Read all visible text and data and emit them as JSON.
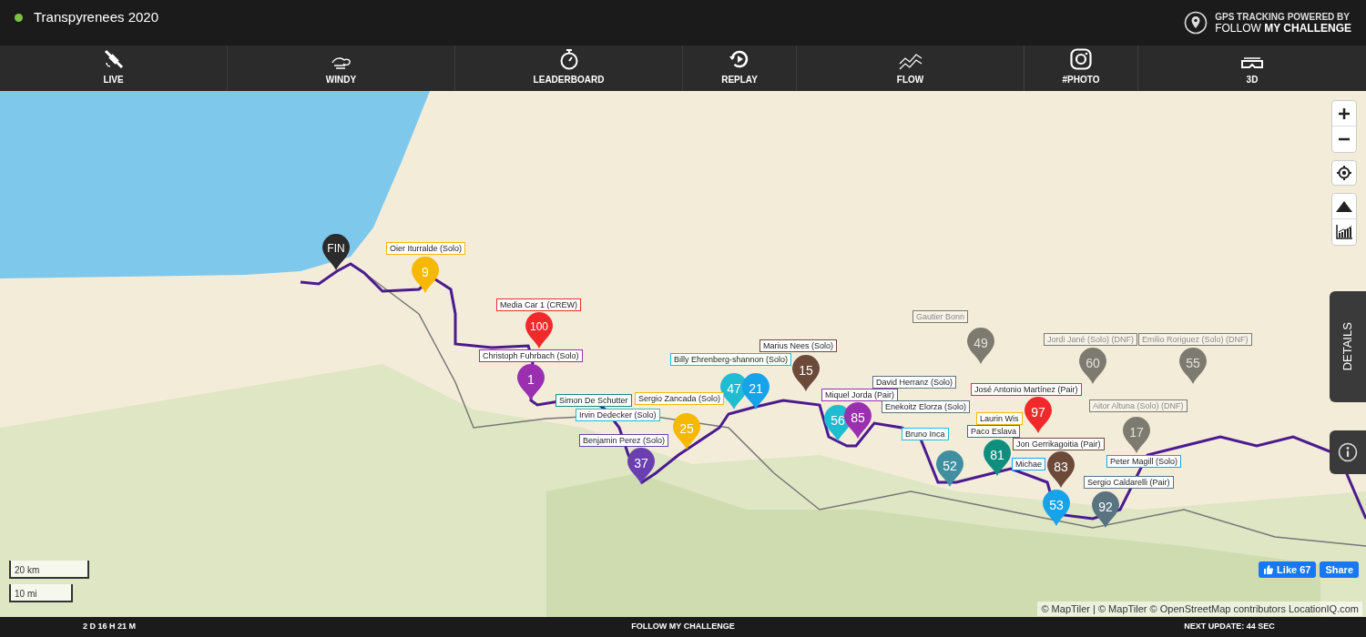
{
  "header": {
    "title": "Transpyrenees 2020",
    "logo_line_1": "GPS TRACKING POWERED BY",
    "logo_line_2_light": "FOLLOW",
    "logo_line_2_bold": "MY CHALLENGE"
  },
  "nav": [
    {
      "label": "LIVE",
      "kind": "live"
    },
    {
      "label": "WINDY",
      "kind": "windy"
    },
    {
      "label": "LEADERBOARD",
      "kind": "leaderboard"
    },
    {
      "label": "REPLAY",
      "kind": "replay"
    },
    {
      "label": "FLOW",
      "kind": "flow"
    },
    {
      "label": "#PHOTO",
      "kind": "photo"
    },
    {
      "label": "3D",
      "kind": "glasses"
    }
  ],
  "map": {
    "markers": [
      {
        "number": "FIN",
        "color": "#2b2b2b",
        "dnf": false
      },
      {
        "number": "9",
        "color": "#f6b800",
        "dnf": false
      },
      {
        "number": "100",
        "color": "#f02a2a",
        "dnf": false
      },
      {
        "number": "1",
        "color": "#9a2fb0",
        "dnf": false
      },
      {
        "number": "47",
        "color": "#1fbcd2",
        "dnf": false
      },
      {
        "number": "21",
        "color": "#16a3ea",
        "dnf": false
      },
      {
        "number": "15",
        "color": "#6b4a3a",
        "dnf": false
      },
      {
        "number": "56",
        "color": "#1fbcd2",
        "dnf": false
      },
      {
        "number": "85",
        "color": "#9a2fb0",
        "dnf": false
      },
      {
        "number": "49",
        "color": "#7d7a70",
        "dnf": true
      },
      {
        "number": "60",
        "color": "#7d7a70",
        "dnf": true
      },
      {
        "number": "55",
        "color": "#7d7a70",
        "dnf": true
      },
      {
        "number": "17",
        "color": "#7d7a70",
        "dnf": true
      },
      {
        "number": "97",
        "color": "#f02a2a",
        "dnf": false
      },
      {
        "number": "81",
        "color": "#0e8f7e",
        "dnf": false
      },
      {
        "number": "83",
        "color": "#6b4a3a",
        "dnf": false
      },
      {
        "number": "53",
        "color": "#16a3ea",
        "dnf": false
      },
      {
        "number": "92",
        "color": "#5a7380",
        "dnf": false
      },
      {
        "number": "37",
        "color": "#6a3fb0",
        "dnf": false
      },
      {
        "number": "25",
        "color": "#f6b800",
        "dnf": false
      },
      {
        "number": "52",
        "color": "#3f8fa0",
        "dnf": false
      }
    ],
    "labels": [
      {
        "text": "Oier Iturralde (Solo)",
        "color": "#f6b800",
        "dnf": false
      },
      {
        "text": "Media Car 1 (CREW)",
        "color": "#f02a2a",
        "dnf": false
      },
      {
        "text": "Christoph Fuhrbach (Solo)",
        "color": "#9a2fb0",
        "dnf": false
      },
      {
        "text": "Simon De Schutter",
        "color": "#0e8f7e",
        "dnf": false
      },
      {
        "text": "Irvin Dedecker (Solo)",
        "color": "#1fbcd2",
        "dnf": false
      },
      {
        "text": "Sergio Zancada (Solo)",
        "color": "#f6b800",
        "dnf": false
      },
      {
        "text": "Benjamin Perez (Solo)",
        "color": "#6a3fb0",
        "dnf": false
      },
      {
        "text": "Billy Ehrenberg-shannon (Solo)",
        "color": "#1fbcd2",
        "dnf": false
      },
      {
        "text": "Marius Nees (Solo)",
        "color": "#6b4a3a",
        "dnf": false
      },
      {
        "text": "Miquel Jorda (Pair)",
        "color": "#9a2fb0",
        "dnf": false
      },
      {
        "text": "David Herranz (Solo)",
        "color": "#5a7380",
        "dnf": false
      },
      {
        "text": "Enekoitz Elorza (Solo)",
        "color": "#5a7380",
        "dnf": false
      },
      {
        "text": "Bruno Inca",
        "color": "#1fbcd2",
        "dnf": false
      },
      {
        "text": "José Antonio Martínez (Pair)",
        "color": "#f02a2a",
        "dnf": false
      },
      {
        "text": "Laurin Wis",
        "color": "#f6b800",
        "dnf": false
      },
      {
        "text": "Paco Eslava",
        "color": "#0e8f7e",
        "dnf": false
      },
      {
        "text": "Jon Gerrikagoitia (Pair)",
        "color": "#6b4a3a",
        "dnf": false
      },
      {
        "text": "Michae",
        "color": "#16a3ea",
        "dnf": false
      },
      {
        "text": "Peter Magill (Solo)",
        "color": "#16a3ea",
        "dnf": false
      },
      {
        "text": "Sergio Caldarelli (Pair)",
        "color": "#5a7380",
        "dnf": false
      },
      {
        "text": "Gautier Bonn",
        "color": "#7d7a70",
        "dnf": true
      },
      {
        "text": "Jordi Jané (Solo) (DNF)",
        "color": "#7d7a70",
        "dnf": true
      },
      {
        "text": "Emilio Roriguez (Solo) (DNF)",
        "color": "#7d7a70",
        "dnf": true
      },
      {
        "text": "Aitor Altuna (Solo) (DNF)",
        "color": "#7d7a70",
        "dnf": true
      }
    ],
    "details_tab": "DETAILS",
    "scale_metric": "20 km",
    "scale_imperial": "10 mi",
    "like_button": "Like 67",
    "share_button": "Share",
    "attribution": "© MapTiler | © MapTiler © OpenStreetMap contributors LocationIQ.com"
  },
  "footer": {
    "elapsed": "2 D 16 H 21 M",
    "center": "FOLLOW MY CHALLENGE",
    "next_update": "NEXT UPDATE: 44 SEC"
  }
}
